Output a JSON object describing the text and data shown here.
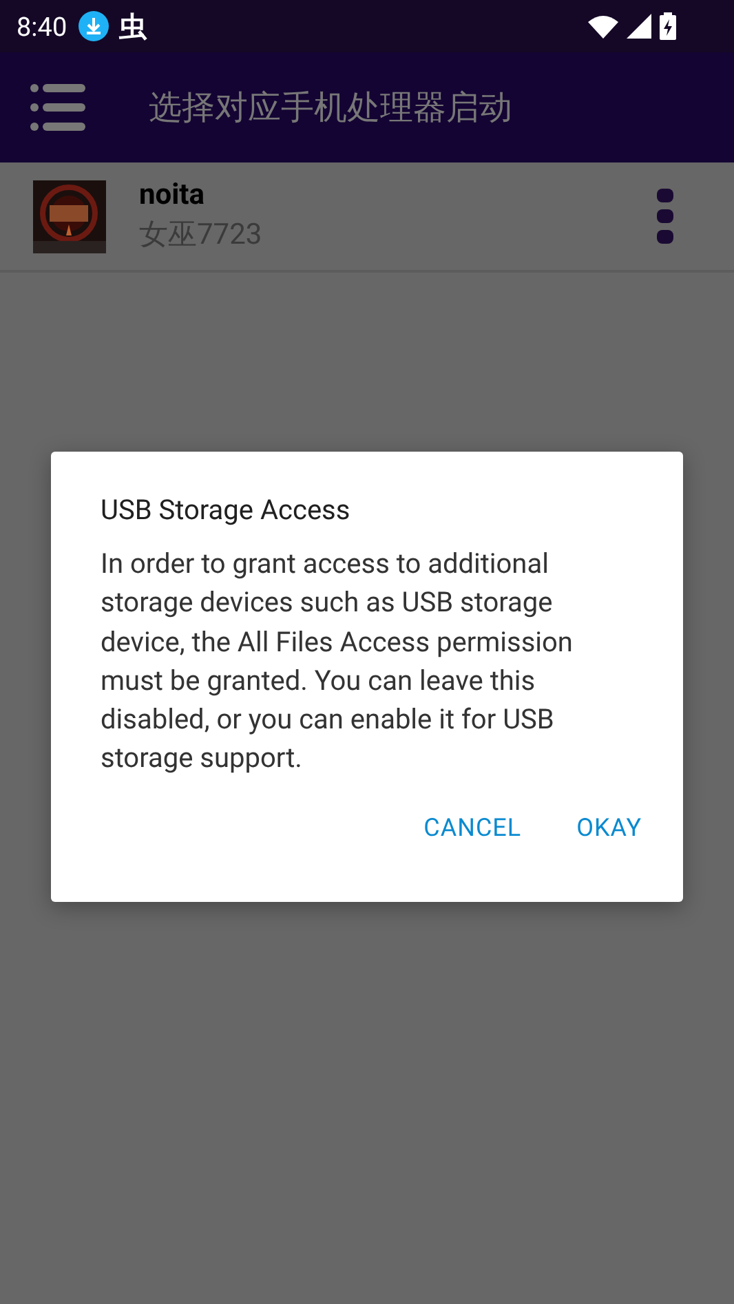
{
  "status_bar": {
    "time": "8:40",
    "notification_glyph": "虫"
  },
  "app_bar": {
    "title": "选择对应手机处理器启动"
  },
  "items": [
    {
      "kind": "picture",
      "name": "noita",
      "subtitle": "女巫7723"
    }
  ],
  "dialog": {
    "title": "USB Storage Access",
    "message": "In order to grant access to additional storage devices such as USB storage device, the All Files Access permission must be granted. You can leave this disabled, or you can enable it for USB storage support.",
    "buttons": [
      "CANCEL",
      "OKAY"
    ]
  }
}
